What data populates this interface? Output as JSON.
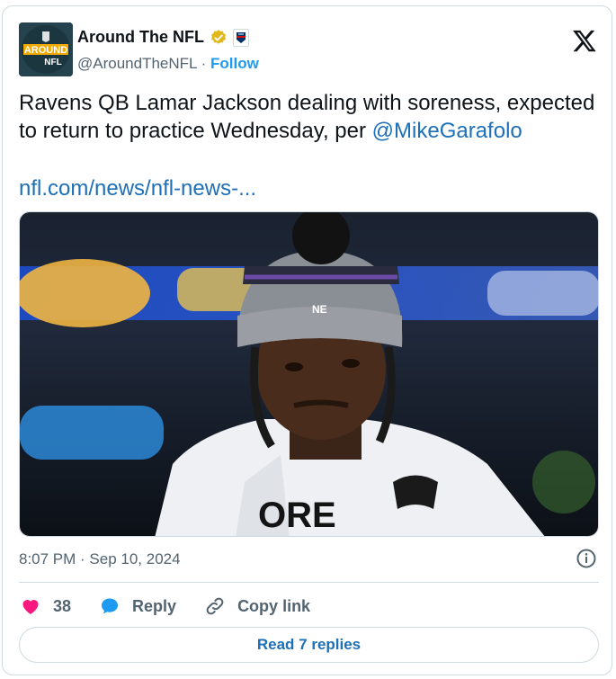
{
  "author": {
    "display_name": "Around The NFL",
    "handle": "@AroundTheNFL",
    "separator": "·",
    "follow_label": "Follow",
    "avatar_text_top": "AROUND",
    "avatar_text_bottom": "NFL"
  },
  "tweet": {
    "text": "Ravens QB Lamar Jackson dealing with soreness, expected to return to practice Wednesday, per ",
    "mention": "@MikeGarafolo",
    "link": "nfl.com/news/nfl-news-...",
    "timestamp": "8:07 PM · Sep 10, 2024"
  },
  "actions": {
    "likes_count": "38",
    "reply_label": "Reply",
    "copy_link_label": "Copy link"
  },
  "footer": {
    "read_replies_label": "Read 7 replies"
  },
  "colors": {
    "link_blue": "#1d6fb8",
    "follow_blue": "#1d9bf0",
    "heart_pink": "#f91880",
    "verified_gold": "#e2b719",
    "muted_gray": "#536471"
  },
  "icons": {
    "brand": "x-logo-icon",
    "verified": "verified-badge-icon",
    "affiliate": "nfl-affiliate-badge-icon",
    "info": "info-icon",
    "like": "heart-icon",
    "reply": "reply-bubble-icon",
    "copy": "link-chain-icon"
  }
}
